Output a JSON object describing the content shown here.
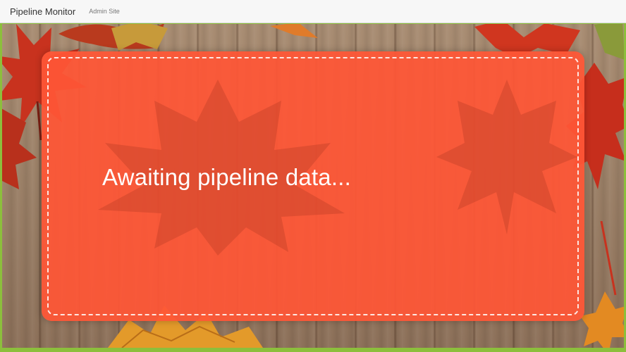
{
  "navbar": {
    "brand": "Pipeline Monitor",
    "admin_link": "Admin Site"
  },
  "status": {
    "message": "Awaiting pipeline data..."
  },
  "colors": {
    "card": "#ff5636",
    "leaf_red": "#c8321e",
    "leaf_orange": "#e8742a",
    "wood": "#9a7f66",
    "page_edge": "#8cbf3c"
  }
}
